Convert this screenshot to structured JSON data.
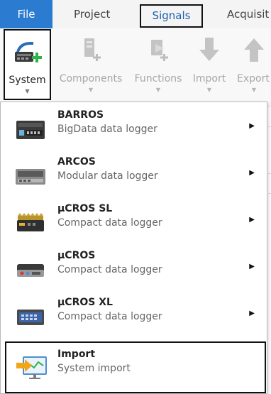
{
  "tabs": [
    {
      "label": "File"
    },
    {
      "label": "Project"
    },
    {
      "label": "Signals"
    },
    {
      "label": "Acquisit"
    }
  ],
  "ribbon": [
    {
      "label": "System",
      "icon": "system-add-icon"
    },
    {
      "label": "Components",
      "icon": "components-add-icon"
    },
    {
      "label": "Functions",
      "icon": "functions-add-icon"
    },
    {
      "label": "Import",
      "icon": "import-arrow-icon"
    },
    {
      "label": "Export",
      "icon": "export-arrow-icon"
    }
  ],
  "menu": {
    "items": [
      {
        "title": "BARROS",
        "subtitle": "BigData data logger"
      },
      {
        "title": "ARCOS",
        "subtitle": "Modular data logger"
      },
      {
        "title": "µCROS SL",
        "subtitle": "Compact data logger"
      },
      {
        "title": "µCROS",
        "subtitle": "Compact data logger"
      },
      {
        "title": "µCROS XL",
        "subtitle": "Compact data logger"
      }
    ],
    "import": {
      "title": "Import",
      "subtitle": "System import"
    }
  },
  "colors": {
    "file_tab": "#2b7bd0",
    "signals_text": "#1f5fb0",
    "add_green": "#2fb24a"
  }
}
